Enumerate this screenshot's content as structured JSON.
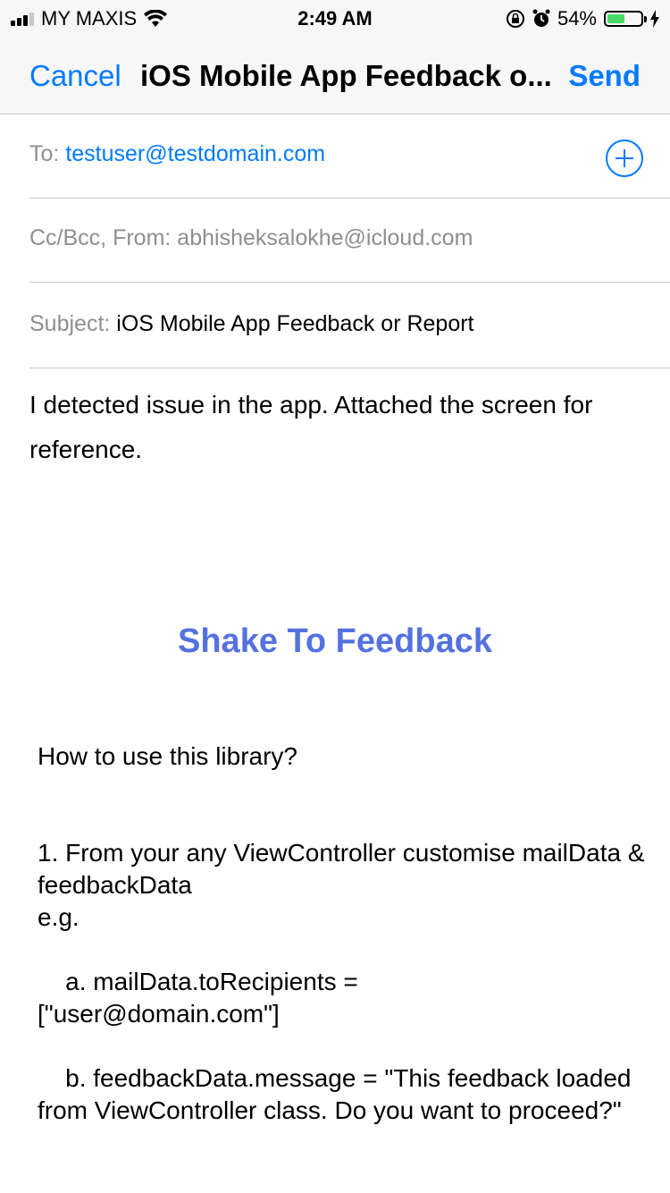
{
  "status_bar": {
    "carrier": "MY MAXIS",
    "time": "2:49 AM",
    "battery_percent": "54%",
    "battery_level": 0.54,
    "battery_color": "#4cd964"
  },
  "nav": {
    "cancel_label": "Cancel",
    "title": "iOS Mobile App Feedback o...",
    "send_label": "Send"
  },
  "to": {
    "label": "To:",
    "value": "testuser@testdomain.com"
  },
  "cc": {
    "label": "Cc/Bcc, From:",
    "value": "abhisheksalokhe@icloud.com"
  },
  "subject": {
    "label": "Subject:",
    "value": "iOS Mobile App Feedback or Report"
  },
  "body": {
    "message": "I detected issue in the app. Attached the screen for reference."
  },
  "attachment": {
    "title": "Shake To Feedback",
    "how_to": "How to use this library?",
    "step1": "1. From your any ViewController customise mailData & feedbackData\ne.g.",
    "step_a": "    a. mailData.toRecipients =\n[\"user@domain.com\"]",
    "step_b": "    b. feedbackData.message = \"This feedback loaded from ViewController class. Do you want to proceed?\""
  },
  "colors": {
    "accent": "#007aff",
    "attachment_title": "#5571e0"
  },
  "icons": [
    "signal-icon",
    "wifi-icon",
    "orientation-lock-icon",
    "alarm-icon",
    "battery-icon",
    "charging-icon",
    "add-contact-icon"
  ]
}
